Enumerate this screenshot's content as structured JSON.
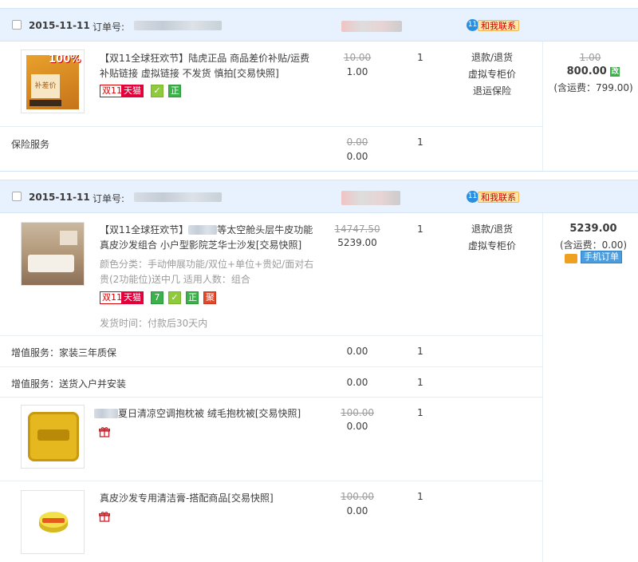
{
  "orders": [
    {
      "date": "2015-11-11",
      "order_no_label": "订单号:",
      "contact_label": "和我联系",
      "item": {
        "title": "【双11全球狂欢节】陆虎正品 商品差价补贴/运费补贴链接 虚拟链接 不发货 慎拍[交易快照]",
        "title_line1": "【双11全球狂欢节】陆虎正品 商品差价补贴/运费",
        "title_line2": "补贴链接 虚拟链接 不发货 慎拍[交易快照]",
        "tags": [
          "双11",
          "天猫"
        ],
        "thumb_badge": "100%",
        "thumb_caption": "补差价",
        "orig_price": "10.00",
        "price": "1.00",
        "qty": "1",
        "ops": [
          "退款/退货",
          "虚拟专柜价",
          "退运保险"
        ]
      },
      "service": {
        "label": "保险服务",
        "orig_price": "0.00",
        "price": "0.00",
        "qty": "1"
      },
      "total": {
        "orig": "1.00",
        "amount": "800.00",
        "edit_badge": "改",
        "shipping": "(含运费：799.00)"
      }
    },
    {
      "date": "2015-11-11",
      "order_no_label": "订单号:",
      "contact_label": "和我联系",
      "item": {
        "title_line1": "【双11全球狂欢节】",
        "title_line1b": "等太空舱头层牛皮功能",
        "title_line2": "真皮沙发组合 小户型影院芝华士沙发[交易快照]",
        "attr_line1": "颜色分类：手动伸展功能/双位+单位+贵妃/面对右",
        "attr_line2": "贵(2功能位)送中几  适用人数：组合",
        "ship_time": "发货时间：付款后30天内",
        "tags": [
          "双11",
          "天猫",
          "7"
        ],
        "orig_price": "14747.50",
        "price": "5239.00",
        "qty": "1",
        "ops": [
          "退款/退货",
          "虚拟专柜价"
        ]
      },
      "services": [
        {
          "label": "增值服务：家装三年质保",
          "price": "0.00",
          "qty": "1"
        },
        {
          "label": "增值服务：送货入户并安装",
          "price": "0.00",
          "qty": "1"
        }
      ],
      "gifts": [
        {
          "title": "夏日清凉空调抱枕被 绒毛抱枕被[交易快照]",
          "orig_price": "100.00",
          "price": "0.00",
          "qty": "1"
        },
        {
          "title": "真皮沙发专用清洁膏-搭配商品[交易快照]",
          "orig_price": "100.00",
          "price": "0.00",
          "qty": "1"
        }
      ],
      "total": {
        "amount": "5239.00",
        "shipping": "(含运费：0.00)",
        "mobile_label": "手机订单"
      }
    }
  ],
  "tag_labels": {
    "double11": "双11",
    "tmall": "天猫",
    "seven": "7",
    "zheng": "正",
    "ju": "聚"
  },
  "colors": {
    "header_bg": "#e8f2ff",
    "accent_red": "#e4003a",
    "link_blue": "#2a8fe0"
  }
}
